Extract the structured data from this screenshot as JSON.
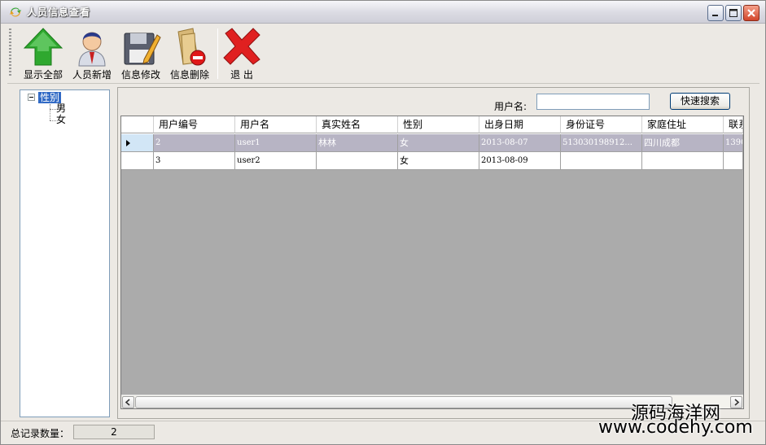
{
  "window": {
    "title": "人员信息查看"
  },
  "toolbar": {
    "show_all": "显示全部",
    "add_person": "人员新增",
    "edit_info": "信息修改",
    "delete_info": "信息删除",
    "exit": "退 出"
  },
  "tree": {
    "root": "性别",
    "children": [
      "男",
      "女"
    ]
  },
  "search": {
    "label": "用户名:",
    "value": "",
    "button": "快速搜索"
  },
  "grid": {
    "columns": [
      "用户编号",
      "用户名",
      "真实姓名",
      "性别",
      "出身日期",
      "身份证号",
      "家庭住址",
      "联系"
    ],
    "rows": [
      [
        "2",
        "user1",
        "林林",
        "女",
        "2013-08-07",
        "513030198912...",
        "四川成都",
        "1390"
      ],
      [
        "3",
        "user2",
        "",
        "女",
        "2013-08-09",
        "",
        "",
        ""
      ]
    ],
    "selected_row": 0
  },
  "status": {
    "label": "总记录数量：",
    "count": "2"
  },
  "watermark": {
    "line1": "源码海洋网",
    "line2": "www.codehy.com"
  }
}
